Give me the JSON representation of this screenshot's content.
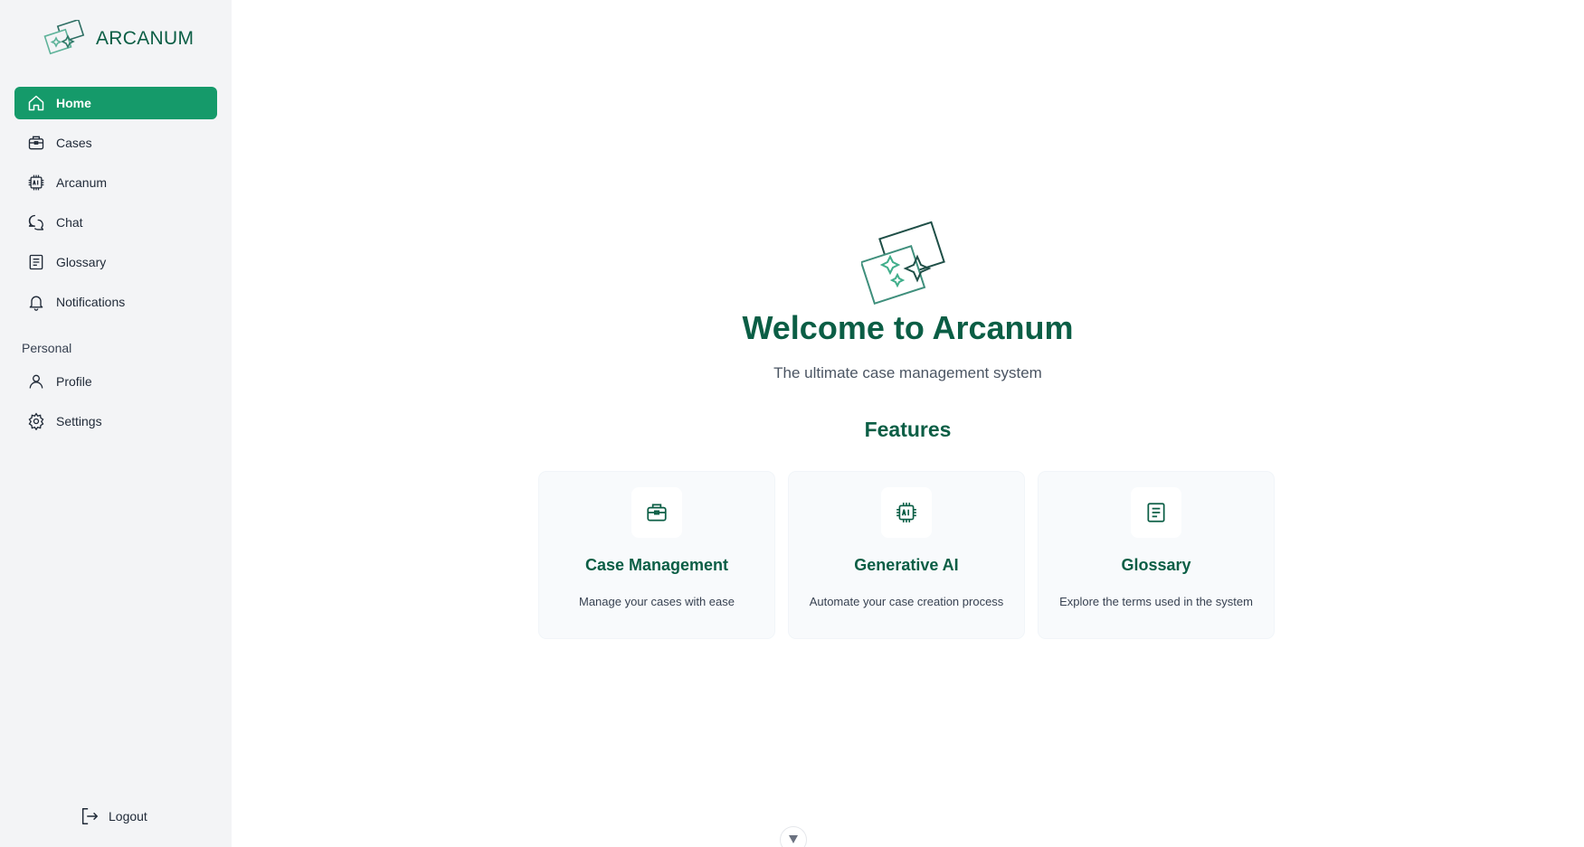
{
  "brand": {
    "name": "ARCANUM"
  },
  "sidebar": {
    "items": [
      {
        "label": "Home",
        "icon": "home-icon",
        "active": true
      },
      {
        "label": "Cases",
        "icon": "briefcase-icon"
      },
      {
        "label": "Arcanum",
        "icon": "ai-chip-icon"
      },
      {
        "label": "Chat",
        "icon": "chat-icon"
      },
      {
        "label": "Glossary",
        "icon": "book-icon"
      },
      {
        "label": "Notifications",
        "icon": "bell-icon"
      }
    ],
    "section_label": "Personal",
    "personal_items": [
      {
        "label": "Profile",
        "icon": "user-icon"
      },
      {
        "label": "Settings",
        "icon": "gear-icon"
      }
    ],
    "logout_label": "Logout"
  },
  "hero": {
    "title": "Welcome to Arcanum",
    "subtitle": "The ultimate case management system"
  },
  "features": {
    "title": "Features",
    "cards": [
      {
        "title": "Case Management",
        "description": "Manage your cases with ease",
        "icon": "briefcase-icon"
      },
      {
        "title": "Generative AI",
        "description": "Automate your case creation process",
        "icon": "ai-chip-icon"
      },
      {
        "title": "Glossary",
        "description": "Explore the terms used in the system",
        "icon": "book-icon"
      }
    ]
  },
  "colors": {
    "accent": "#159a6a",
    "brand_text": "#0b5e45",
    "sidebar_bg": "#f3f4f6"
  }
}
